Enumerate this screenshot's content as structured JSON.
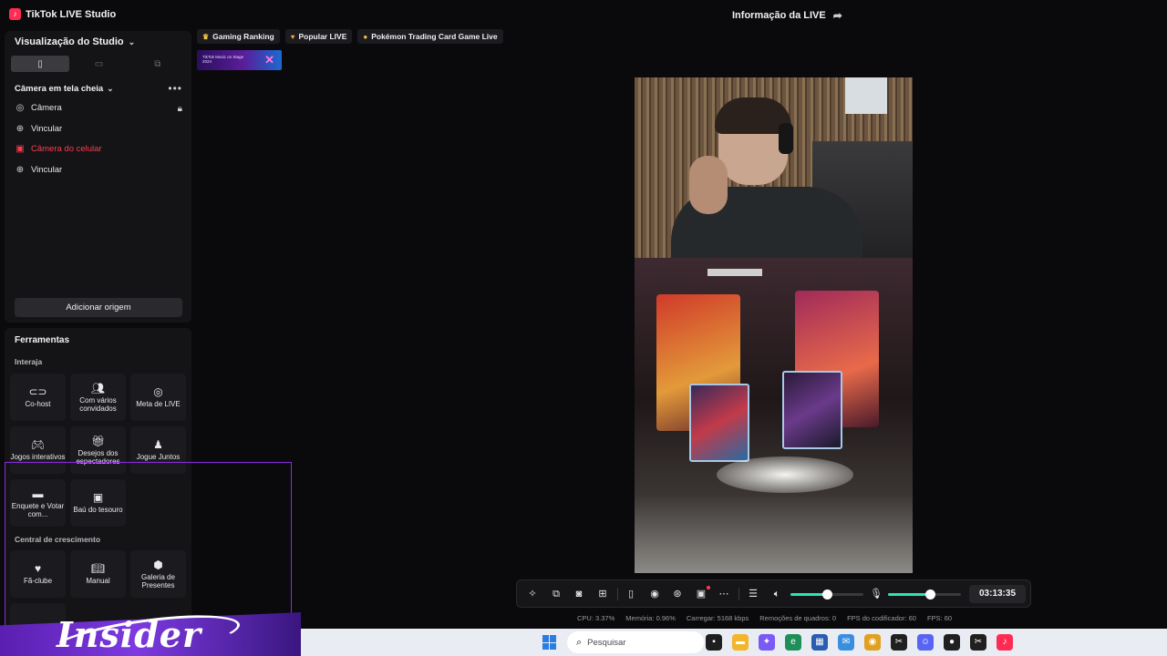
{
  "app": {
    "title": "TikTok LIVE Studio",
    "live_info": "Informação da LIVE"
  },
  "studio": {
    "view_label": "Visualização do Studio",
    "scene_label": "Câmera em tela cheia",
    "sources": [
      {
        "label": "Câmera",
        "icon": "camera-icon",
        "state": "normal"
      },
      {
        "label": "Vincular",
        "icon": "globe-icon",
        "state": "normal"
      },
      {
        "label": "Câmera do celular",
        "icon": "phone-camera-icon",
        "state": "error"
      },
      {
        "label": "Vincular",
        "icon": "globe-icon",
        "state": "normal"
      }
    ],
    "add_source": "Adicionar origem"
  },
  "tools": {
    "title": "Ferramentas",
    "section_interact": "Interaja",
    "section_growth": "Central de crescimento",
    "interact": [
      {
        "label": "Co-host",
        "icon": "link-icon"
      },
      {
        "label": "Com vários convidados",
        "icon": "multi-guest-icon"
      },
      {
        "label": "Meta de LIVE",
        "icon": "target-icon"
      },
      {
        "label": "Jogos interativos",
        "icon": "gamepad-icon"
      },
      {
        "label": "Desejos dos espectadores",
        "icon": "gift-icon"
      },
      {
        "label": "Jogue Juntos",
        "icon": "joystick-icon"
      },
      {
        "label": "Enquete e Votar com...",
        "icon": "poll-icon"
      },
      {
        "label": "Baú do tesouro",
        "icon": "chest-icon"
      }
    ],
    "growth": [
      {
        "label": "Fã-clube",
        "icon": "heart-icon"
      },
      {
        "label": "Manual",
        "icon": "book-icon"
      },
      {
        "label": "Galeria de Presentes",
        "icon": "gift-gallery-icon"
      }
    ]
  },
  "chips": [
    {
      "label": "Gaming Ranking",
      "icon": "crown-icon",
      "color": "#f5c542"
    },
    {
      "label": "Popular LIVE",
      "icon": "heart-icon",
      "color": "#f5a142"
    },
    {
      "label": "Pokémon Trading Card Game Live",
      "icon": "pokeball-icon",
      "color": "#f5c542"
    }
  ],
  "banner": {
    "text": "TikTok Music on Stage 2024"
  },
  "controls": {
    "timer": "03:13:35",
    "speaker_level": 0.5,
    "mic_level": 0.58,
    "accent": "#2fe3b4"
  },
  "stats": {
    "cpu": "CPU: 3.37%",
    "memory": "Memória: 0.96%",
    "upload": "Carregar: 5168 kbps",
    "dropped": "Remoções de quadros: 0",
    "encoder_fps": "FPS do codificador: 60",
    "fps": "FPS: 60"
  },
  "overlay": {
    "brand": "Insider"
  },
  "taskbar": {
    "search_placeholder": "Pesquisar"
  }
}
